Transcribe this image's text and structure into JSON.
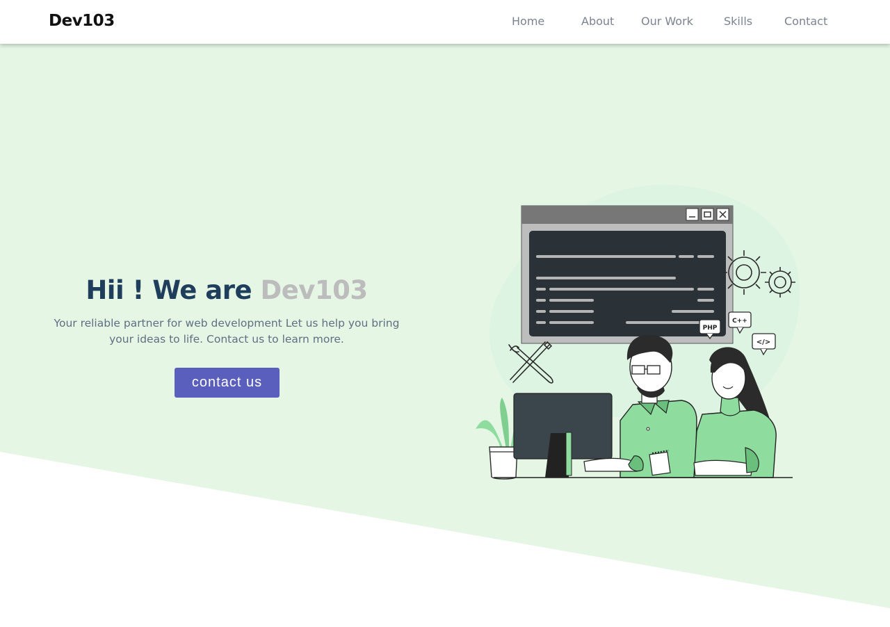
{
  "nav": {
    "brand": "Dev103",
    "links": [
      "Home",
      "About",
      "Our Work",
      "Skills",
      "Contact"
    ]
  },
  "hero": {
    "title_main": "Hii ! We are",
    "title_accent": "Dev103",
    "subtitle_line1": "Your reliable partner for web development Let us help you bring",
    "subtitle_line2": "your ideas to life. Contact us to learn more.",
    "cta_label": "contact us"
  },
  "illustration": {
    "tags": [
      "PHP",
      "C++",
      "</>"
    ]
  },
  "colors": {
    "hero_background": "#e5f6e5",
    "title": "#1f3e5c",
    "accent": "#bcbcbc",
    "button": "#5a5fbd",
    "illustration_green": "#8fdc9f"
  }
}
